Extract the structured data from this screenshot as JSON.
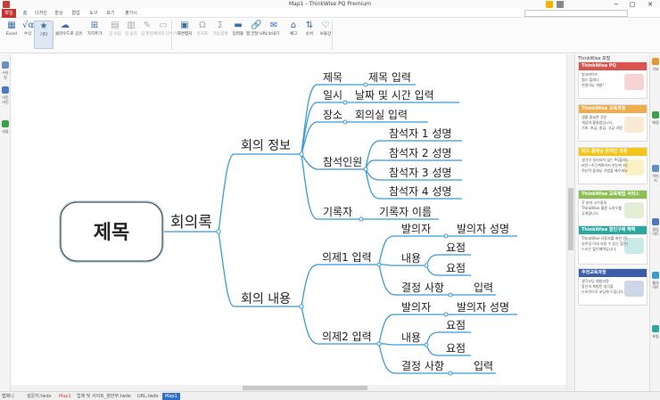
{
  "window": {
    "title": "Map1 - ThinkWise PQ Premium",
    "minimize": "−",
    "maximize": "□",
    "close": "✕"
  },
  "menu": {
    "items": [
      "파일",
      "홈",
      "디자인",
      "발상",
      "협업",
      "도구",
      "보기",
      "평가시"
    ],
    "active_index": 0
  },
  "ribbon": {
    "buttons": [
      {
        "label": "Excel",
        "icon": "excel-icon",
        "glyph": "▦"
      },
      {
        "label": "수식",
        "icon": "formula-icon",
        "glyph": "√α"
      },
      {
        "label": "기타",
        "icon": "star-icon",
        "glyph": "★"
      },
      {
        "label": "클라우드로 공유",
        "icon": "cloud-share-icon",
        "glyph": "☁"
      },
      {
        "label": "가지추가",
        "icon": "add-branch-icon",
        "glyph": "⊞"
      },
      {
        "label": "잠 보임",
        "icon": "show-icon",
        "glyph": "▤"
      },
      {
        "label": "잠 숨김",
        "icon": "hide-icon",
        "glyph": "▥"
      },
      {
        "label": "잠 편집",
        "icon": "edit-icon",
        "glyph": "✎"
      },
      {
        "label": "페이지 나누기",
        "icon": "page-break-icon",
        "glyph": "▭"
      },
      {
        "label": "화면캡처",
        "icon": "screen-capture-icon",
        "glyph": "▣"
      },
      {
        "label": "문자표",
        "icon": "omega-icon",
        "glyph": "Ω"
      },
      {
        "label": "자동합계",
        "icon": "sigma-icon",
        "glyph": "Σ"
      },
      {
        "label": "입력줄",
        "icon": "input-bar-icon",
        "glyph": "▬"
      },
      {
        "label": "맵 전달 URL",
        "icon": "link-icon",
        "glyph": "🔗"
      },
      {
        "label": "보내기",
        "icon": "send-icon",
        "glyph": "✉"
      },
      {
        "label": "채그",
        "icon": "tag-icon",
        "glyph": "⌂"
      },
      {
        "label": "순서",
        "icon": "sort-icon",
        "glyph": "⇅"
      },
      {
        "label": "보물상",
        "icon": "lock-icon",
        "glyph": "♡"
      }
    ],
    "groups": [
      "자료",
      "주요",
      "기타"
    ]
  },
  "left_sidebar": {
    "items": [
      "스타일",
      "아웃라인",
      "내용"
    ]
  },
  "mindmap": {
    "root": "제목",
    "level1": "회의록",
    "branches": {
      "info": "회의 정보",
      "content": "회의 내용"
    },
    "info_items": {
      "title_label": "제목",
      "title_value": "제목 입력",
      "date_label": "일시",
      "date_value": "날짜 및 시간 입력",
      "place_label": "장소",
      "place_value": "회의실 입력",
      "attendees_label": "참석인원",
      "attendees": [
        "참석자 1 성명",
        "참석자 2 성명",
        "참석자 3 성명",
        "참석자 4 성명"
      ],
      "recorder_label": "기록자",
      "recorder_value": "기록자 이름"
    },
    "agenda": [
      {
        "label": "의제1 입력",
        "presenter_label": "발의자",
        "presenter_value": "발의자 성명",
        "content_label": "내용",
        "points": [
          "요점",
          "요점"
        ],
        "decision_label": "결정 사항",
        "decision_value": "입력"
      },
      {
        "label": "의제2 입력",
        "presenter_label": "발의자",
        "presenter_value": "발의자 성명",
        "content_label": "내용",
        "points": [
          "요점",
          "요점"
        ],
        "decision_label": "결정 사항",
        "decision_value": "입력"
      }
    ]
  },
  "right_panel": {
    "title": "ThinkWise 포털",
    "cards": [
      {
        "header": "ThinkWise PQ",
        "color": "#d9534f",
        "line1": "씽크와이즈",
        "line2": "맵스 플래너",
        "line3": "연결기능 개발!"
      },
      {
        "header": "ThinkWise 교육과정",
        "color": "#f0ad4e",
        "line1": "생활 중요한 것은",
        "line2": "개념과 활용법입니다.",
        "line3": "기초, 초급, 중급, 고급 과정"
      },
      {
        "header": "비즈 플래닝 온라인 과정",
        "color": "#f5c518",
        "line1": "생각이 정리되지 않는 PQ플래닝 기업",
        "line2": "비전~주간계획까지 한눈에 봐는",
        "line3": "혁신적 플래닝 기법을 배우세요"
      },
      {
        "header": "ThinkWise 교육제법 서비스",
        "color": "#8cc152",
        "line1": "각 분야 고수들의",
        "line2": "ThinkWise 활용 노하우를",
        "line3": "공개합니다."
      },
      {
        "header": "ThinkWise 할인구매 혜택",
        "color": "#2aa7a0",
        "line1": "ThinkWise 사용자를 위한 안내합니다.",
        "line2": "일주일 이내 사용 수 있는 할인혜택",
        "line3": "드리는 할인혜택입니다."
      },
      {
        "header": "추천교육과정",
        "color": "#3b5ea8",
        "line1": "생각코딩 체험과정",
        "line2": "함인의 체험된 생각을",
        "line3": "논리적으로 코딩해 드립니다"
      }
    ]
  },
  "right_sidebar": {
    "items": [
      "기호",
      "배경",
      "이미지",
      "클립아트",
      "웹사이트",
      "포털"
    ]
  },
  "status_tabs": [
    "맵매니",
    "설문지.twdx",
    "Map1",
    "업체 및 사이트_정만부.twdx",
    "URL.twdx",
    "Map1"
  ],
  "status_active_index": 5
}
